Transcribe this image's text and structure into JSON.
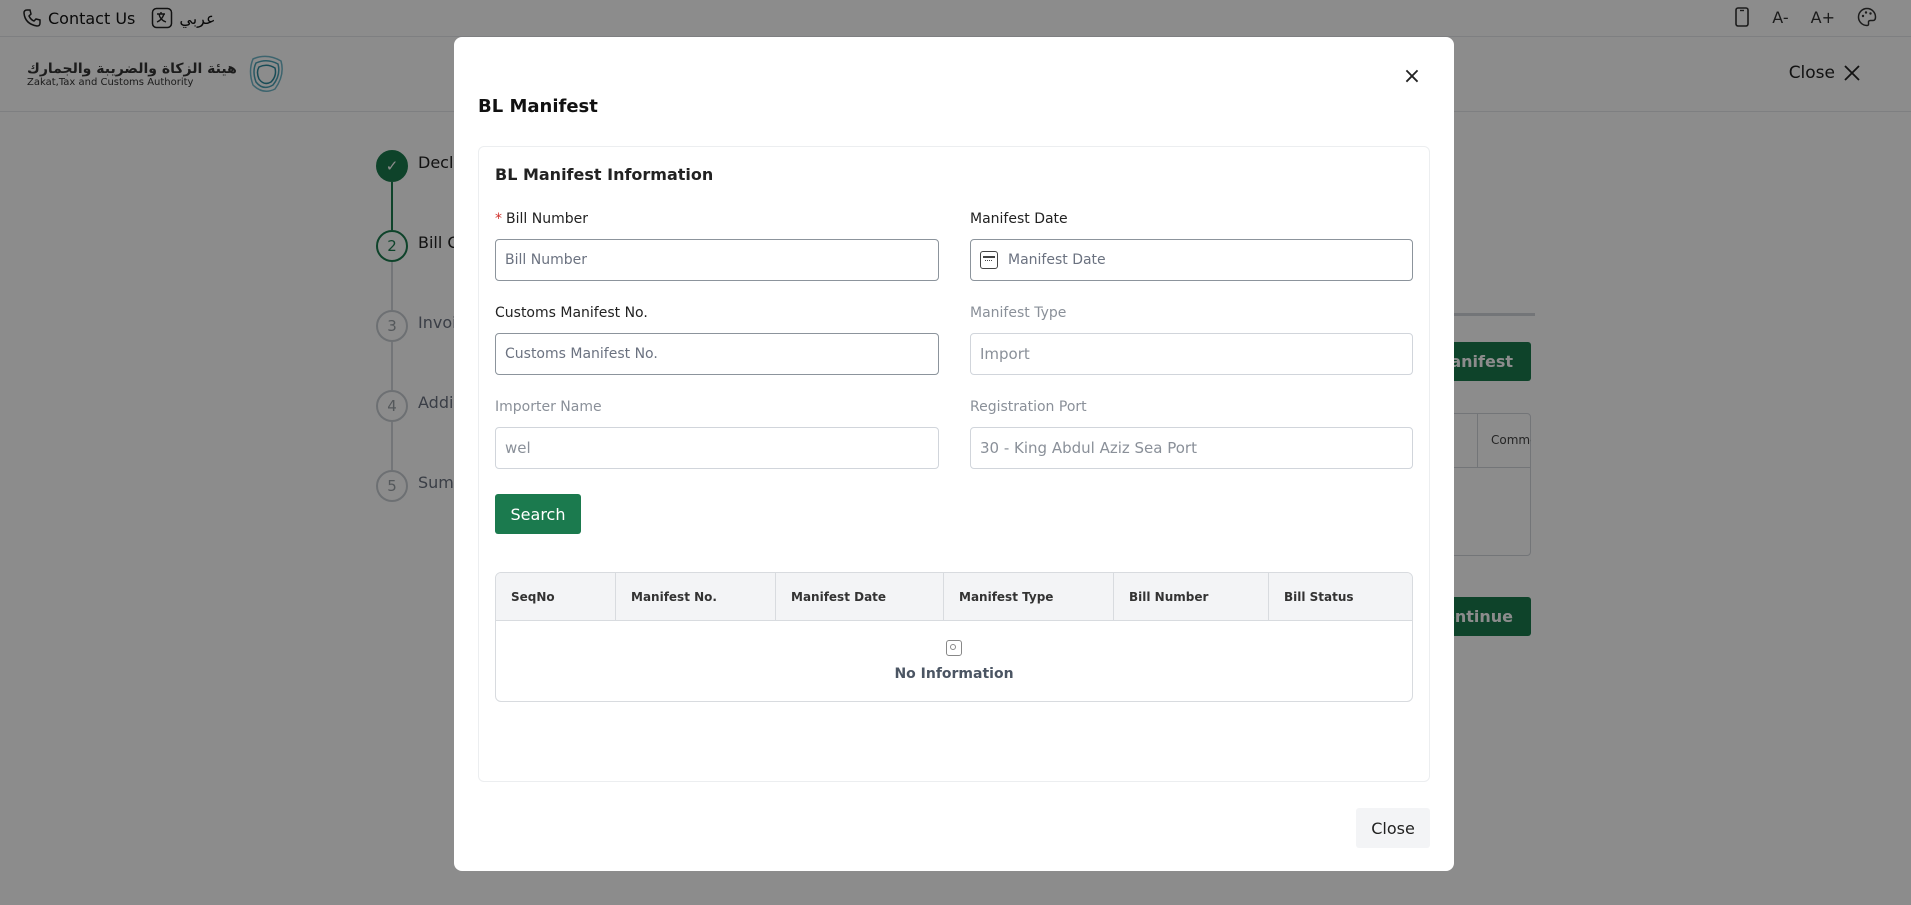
{
  "topbar": {
    "contact_label": "Contact Us",
    "language_label": "عربي",
    "font_decrease": "A-",
    "font_increase": "A+"
  },
  "header": {
    "logo_ar": "هيئة الزكاة والضريبة والجمارك",
    "logo_en": "Zakat,Tax and Customs Authority",
    "close_label": "Close"
  },
  "stepper": {
    "steps": [
      {
        "number": "✓",
        "label": "Decla"
      },
      {
        "number": "2",
        "label": "Bill C"
      },
      {
        "number": "3",
        "label": "Invoi"
      },
      {
        "number": "4",
        "label": "Addi"
      },
      {
        "number": "5",
        "label": "Sumr"
      }
    ]
  },
  "background": {
    "manifest_btn": "Manifest",
    "continue_btn": "Continue",
    "table_col": "Comme"
  },
  "modal": {
    "title": "BL Manifest",
    "section_title": "BL Manifest Information",
    "fields": {
      "bill_number": {
        "label": "Bill Number",
        "required": "*",
        "placeholder": "Bill Number",
        "value": ""
      },
      "manifest_date": {
        "label": "Manifest Date",
        "placeholder": "Manifest Date",
        "value": ""
      },
      "customs_manifest_no": {
        "label": "Customs Manifest No.",
        "placeholder": "Customs Manifest No.",
        "value": ""
      },
      "manifest_type": {
        "label": "Manifest Type",
        "value": "Import"
      },
      "importer_name": {
        "label": "Importer Name",
        "value": "wel"
      },
      "registration_port": {
        "label": "Registration Port",
        "value": "30 - King Abdul Aziz Sea Port"
      }
    },
    "search_label": "Search",
    "table": {
      "columns": [
        "SeqNo",
        "Manifest No.",
        "Manifest Date",
        "Manifest Type",
        "Bill Number",
        "Bill Status"
      ],
      "empty_text": "No Information"
    },
    "close_label": "Close",
    "close_icon": "×"
  },
  "colors": {
    "primary": "#1b7a4e",
    "overlay": "rgba(0,0,0,0.45)",
    "required": "#d0312d"
  }
}
